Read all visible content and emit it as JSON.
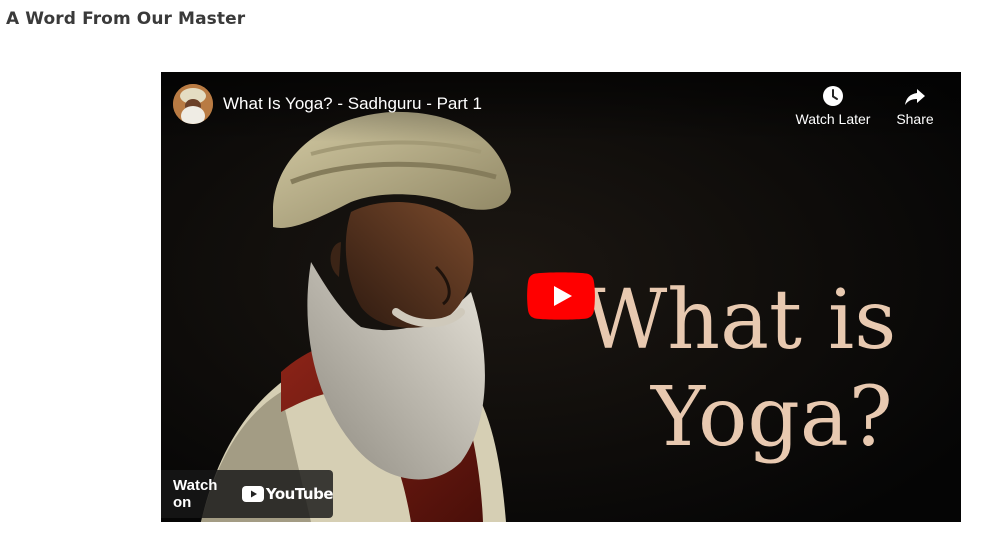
{
  "section": {
    "title": "A Word From Our Master"
  },
  "video": {
    "title": "What Is Yoga? - Sadhguru - Part 1",
    "watch_later_label": "Watch Later",
    "share_label": "Share",
    "thumbnail_text_line1": "What is",
    "thumbnail_text_line2": "Yoga?",
    "watch_on_label": "Watch on",
    "platform_name": "YouTube"
  },
  "icons": {
    "avatar": "channel-avatar",
    "watch_later": "clock-icon",
    "share": "share-arrow-icon",
    "play": "youtube-play-icon",
    "logo": "youtube-logo-icon"
  },
  "colors": {
    "play_red": "#ff0000",
    "overlay_text": "#e8c9b0",
    "heading": "#3a3a3a"
  }
}
